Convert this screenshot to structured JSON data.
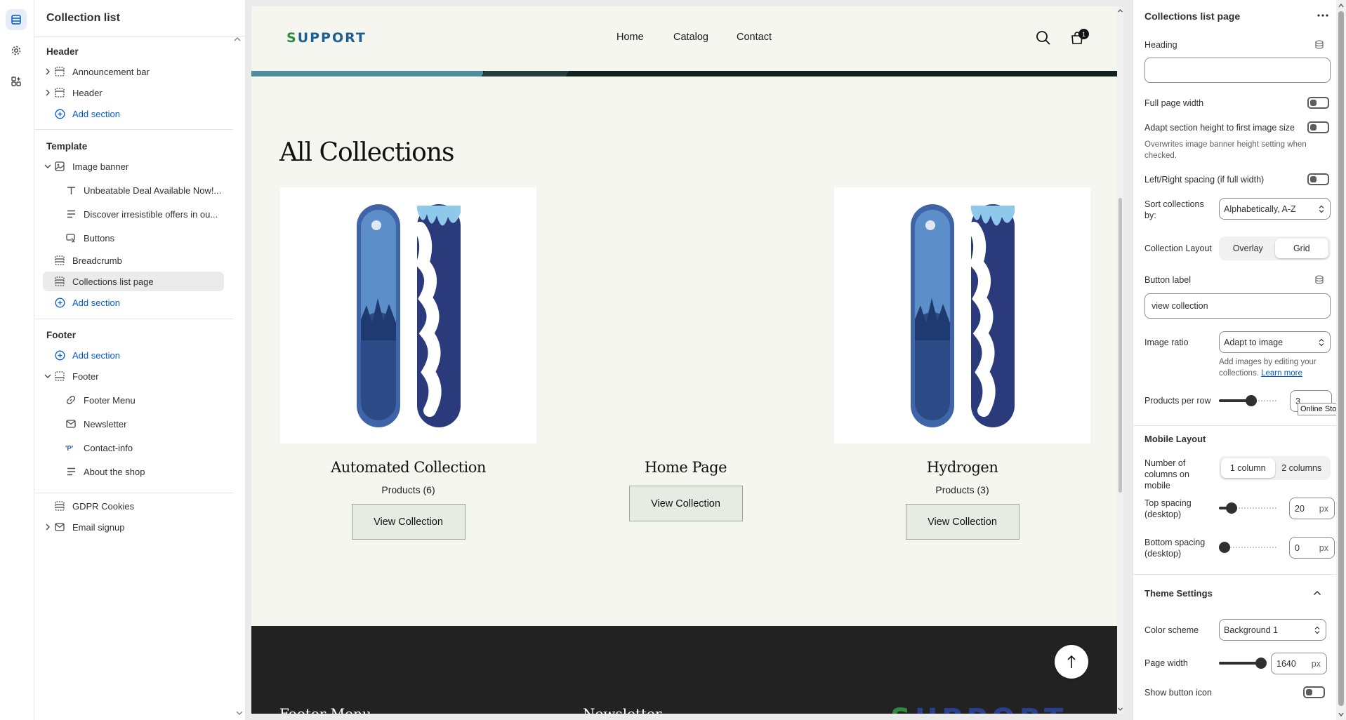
{
  "sidebar": {
    "title": "Collection list",
    "header_group": "Header",
    "header_items": [
      "Announcement bar",
      "Header"
    ],
    "add_section": "Add section",
    "template_group": "Template",
    "template_items": {
      "image_banner": "Image banner",
      "banner_text": "Unbeatable Deal Available Now!...",
      "banner_desc": "Discover irresistible offers in ou...",
      "banner_buttons": "Buttons",
      "breadcrumb": "Breadcrumb",
      "collections_list_page": "Collections list page"
    },
    "footer_group": "Footer",
    "footer_items": {
      "footer": "Footer",
      "footer_menu": "Footer Menu",
      "newsletter": "Newsletter",
      "contact_info": "Contact-info",
      "about_shop": "About the shop",
      "gdpr": "GDPR Cookies",
      "email_signup": "Email signup"
    }
  },
  "store": {
    "logo_first": "S",
    "logo_rest": "UPPORT",
    "nav": [
      "Home",
      "Catalog",
      "Contact"
    ],
    "cart_count": "1",
    "page_title": "All Collections",
    "collections": [
      {
        "name": "Automated Collection",
        "count": "Products (6)",
        "button": "View Collection"
      },
      {
        "name": "Home Page",
        "count": "",
        "button": "View Collection"
      },
      {
        "name": "Hydrogen",
        "count": "Products (3)",
        "button": "View Collection"
      }
    ],
    "footer_headings": [
      "Footer Menu",
      "Newsletter"
    ]
  },
  "settings": {
    "title": "Collections list page",
    "heading_label": "Heading",
    "heading_value": "",
    "full_width": "Full page width",
    "adapt_height": "Adapt section height to first image size",
    "adapt_help": "Overwrites image banner height setting when checked.",
    "lr_spacing": "Left/Right spacing (if full width)",
    "sort_label": "Sort collections by:",
    "sort_value": "Alphabetically, A-Z",
    "layout_label": "Collection Layout",
    "layout_options": [
      "Overlay",
      "Grid"
    ],
    "layout_selected": "Grid",
    "button_label": "Button label",
    "button_value": "view collection",
    "ratio_label": "Image ratio",
    "ratio_value": "Adapt to image",
    "ratio_help": "Add images by editing your collections.",
    "ratio_link": "Learn more",
    "products_row": "Products per row",
    "products_row_value": "3",
    "tooltip": "Online Store",
    "mobile_title": "Mobile Layout",
    "mobile_cols_label": "Number of columns on mobile",
    "mobile_cols_options": [
      "1 column",
      "2 columns"
    ],
    "mobile_cols_selected": "1 column",
    "top_spacing_label": "Top spacing (desktop)",
    "top_spacing_value": "20",
    "bottom_spacing_label": "Bottom spacing (desktop)",
    "bottom_spacing_value": "0",
    "unit": "px",
    "theme_title": "Theme Settings",
    "color_scheme_label": "Color scheme",
    "color_scheme_value": "Background 1",
    "page_width_label": "Page width",
    "page_width_value": "1640",
    "show_button_icon": "Show button icon"
  },
  "colors": {
    "accent": "#005bd3",
    "preview_bg": "#f4f6ef",
    "footer_bg": "#222222"
  }
}
